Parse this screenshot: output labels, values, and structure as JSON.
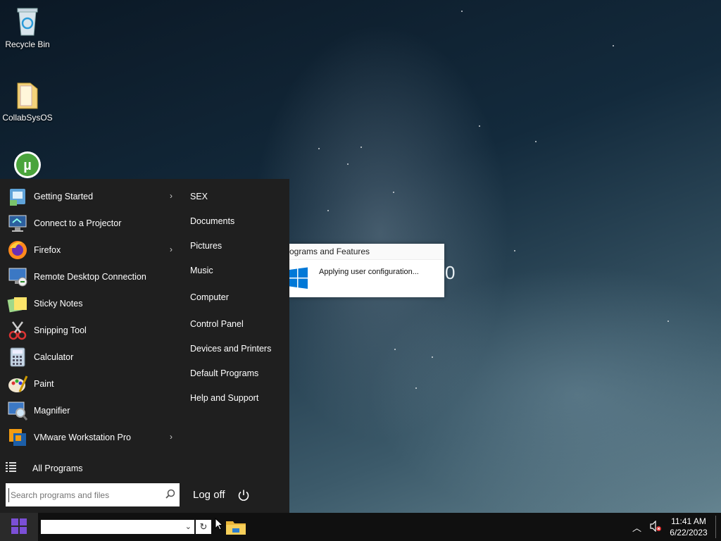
{
  "desktop": {
    "icons": [
      {
        "label": "Recycle Bin",
        "icon": "recycle-bin-icon"
      },
      {
        "label": "CollabSysOS",
        "icon": "folder-icon"
      },
      {
        "label": "",
        "icon": "utorrent-icon"
      }
    ]
  },
  "dialog": {
    "title": "ograms and Features",
    "message": "Applying user configuration...",
    "ghost_text": "0"
  },
  "start_menu": {
    "programs": [
      {
        "label": "Getting Started",
        "icon": "getting-started-icon",
        "has_submenu": true
      },
      {
        "label": "Connect to a Projector",
        "icon": "projector-icon",
        "has_submenu": false
      },
      {
        "label": "Firefox",
        "icon": "firefox-icon",
        "has_submenu": true
      },
      {
        "label": "Remote Desktop Connection",
        "icon": "remote-desktop-icon",
        "has_submenu": false
      },
      {
        "label": "Sticky Notes",
        "icon": "sticky-notes-icon",
        "has_submenu": false
      },
      {
        "label": "Snipping Tool",
        "icon": "snipping-tool-icon",
        "has_submenu": false
      },
      {
        "label": "Calculator",
        "icon": "calculator-icon",
        "has_submenu": false
      },
      {
        "label": "Paint",
        "icon": "paint-icon",
        "has_submenu": false
      },
      {
        "label": "Magnifier",
        "icon": "magnifier-icon",
        "has_submenu": false
      },
      {
        "label": "VMware Workstation Pro",
        "icon": "vmware-icon",
        "has_submenu": true
      }
    ],
    "all_programs": "All Programs",
    "places": [
      "SEX",
      "Documents",
      "Pictures",
      "Music",
      "Computer",
      "Control Panel",
      "Devices and Printers",
      "Default Programs",
      "Help and Support"
    ],
    "search_placeholder": "Search programs and files",
    "log_off": "Log off"
  },
  "taskbar": {
    "address_value": "",
    "clock_time": "11:41 AM",
    "clock_date": "6/22/2023"
  },
  "colors": {
    "start_menu_bg": "#1f1f1f",
    "taskbar_bg": "#101010",
    "start_logo": "#7b4fd6",
    "windows_blue": "#0078d7"
  }
}
